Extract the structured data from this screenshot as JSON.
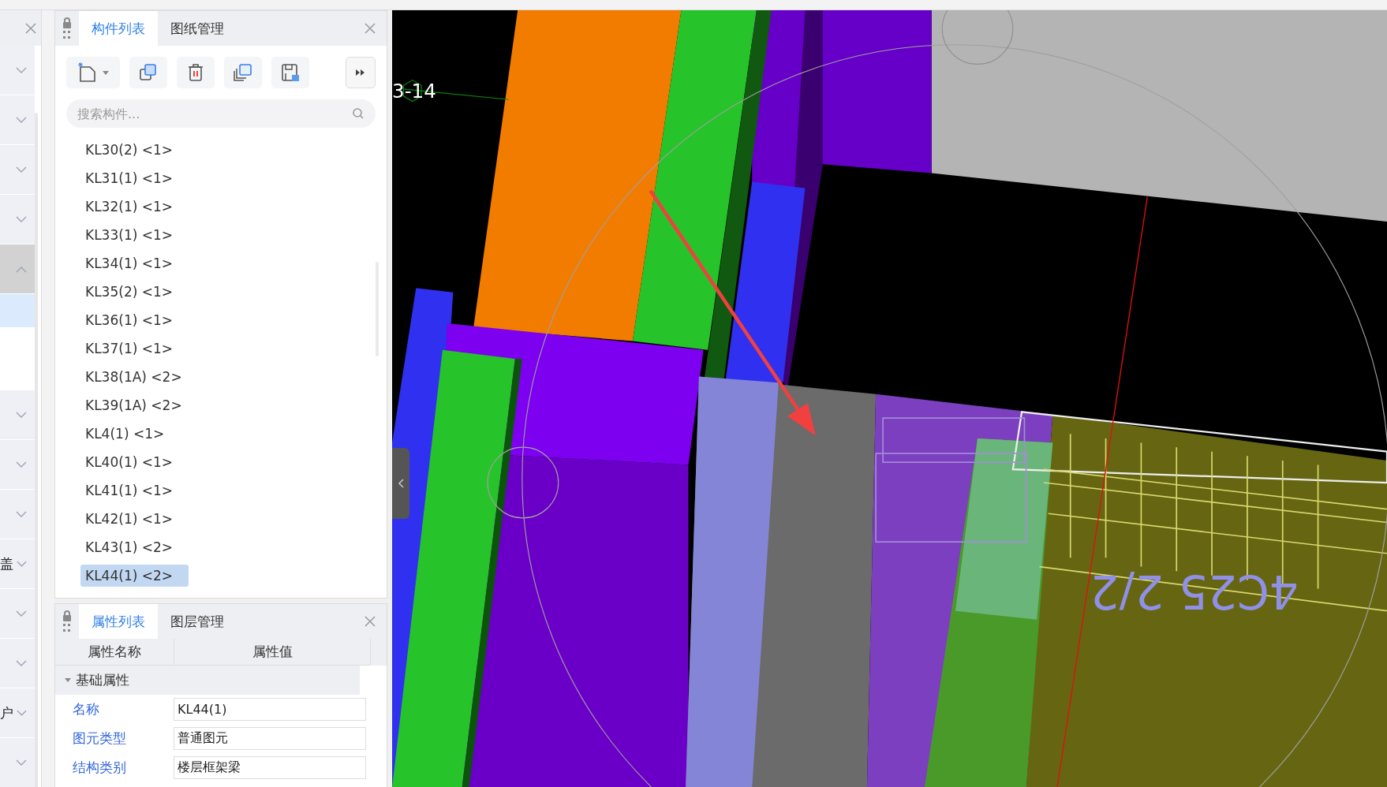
{
  "sidebar": {
    "groups": [
      {
        "expanded": false
      },
      {
        "expanded": false
      },
      {
        "expanded": false
      },
      {
        "expanded": false
      },
      {
        "expanded": true,
        "children": [
          {
            "selected": true
          }
        ]
      },
      {
        "expanded": false
      },
      {
        "expanded": false
      },
      {
        "expanded": false
      },
      {
        "expanded": false,
        "label": "盖"
      },
      {
        "expanded": false
      },
      {
        "expanded": false
      },
      {
        "expanded": false,
        "label": "户"
      },
      {
        "expanded": false
      }
    ]
  },
  "component_panel": {
    "tabs": [
      {
        "label": "构件列表",
        "selected": true
      },
      {
        "label": "图纸管理",
        "selected": false
      }
    ],
    "search": {
      "placeholder": "搜索构件..."
    },
    "items": [
      {
        "label": "KL30(2) <1>",
        "selected": false
      },
      {
        "label": "KL31(1) <1>",
        "selected": false
      },
      {
        "label": "KL32(1) <1>",
        "selected": false
      },
      {
        "label": "KL33(1) <1>",
        "selected": false
      },
      {
        "label": "KL34(1) <1>",
        "selected": false
      },
      {
        "label": "KL35(2) <1>",
        "selected": false
      },
      {
        "label": "KL36(1) <1>",
        "selected": false
      },
      {
        "label": "KL37(1) <1>",
        "selected": false
      },
      {
        "label": "KL38(1A) <2>",
        "selected": false
      },
      {
        "label": "KL39(1A) <2>",
        "selected": false
      },
      {
        "label": "KL4(1) <1>",
        "selected": false
      },
      {
        "label": "KL40(1) <1>",
        "selected": false
      },
      {
        "label": "KL41(1) <1>",
        "selected": false
      },
      {
        "label": "KL42(1) <1>",
        "selected": false
      },
      {
        "label": "KL43(1) <2>",
        "selected": false
      },
      {
        "label": "KL44(1) <2>",
        "selected": true
      }
    ]
  },
  "property_panel": {
    "tabs": [
      {
        "label": "属性列表",
        "selected": true
      },
      {
        "label": "图层管理",
        "selected": false
      }
    ],
    "columns": [
      "属性名称",
      "属性值"
    ],
    "group": {
      "label": "基础属性",
      "expanded": true
    },
    "rows": [
      {
        "name": "名称",
        "value": "KL44(1)"
      },
      {
        "name": "图元类型",
        "value": "普通图元"
      },
      {
        "name": "结构类别",
        "value": "楼层框架梁"
      }
    ]
  },
  "viewport": {
    "axis_label": "3-14",
    "rebar_label": "4C25 2/2"
  }
}
